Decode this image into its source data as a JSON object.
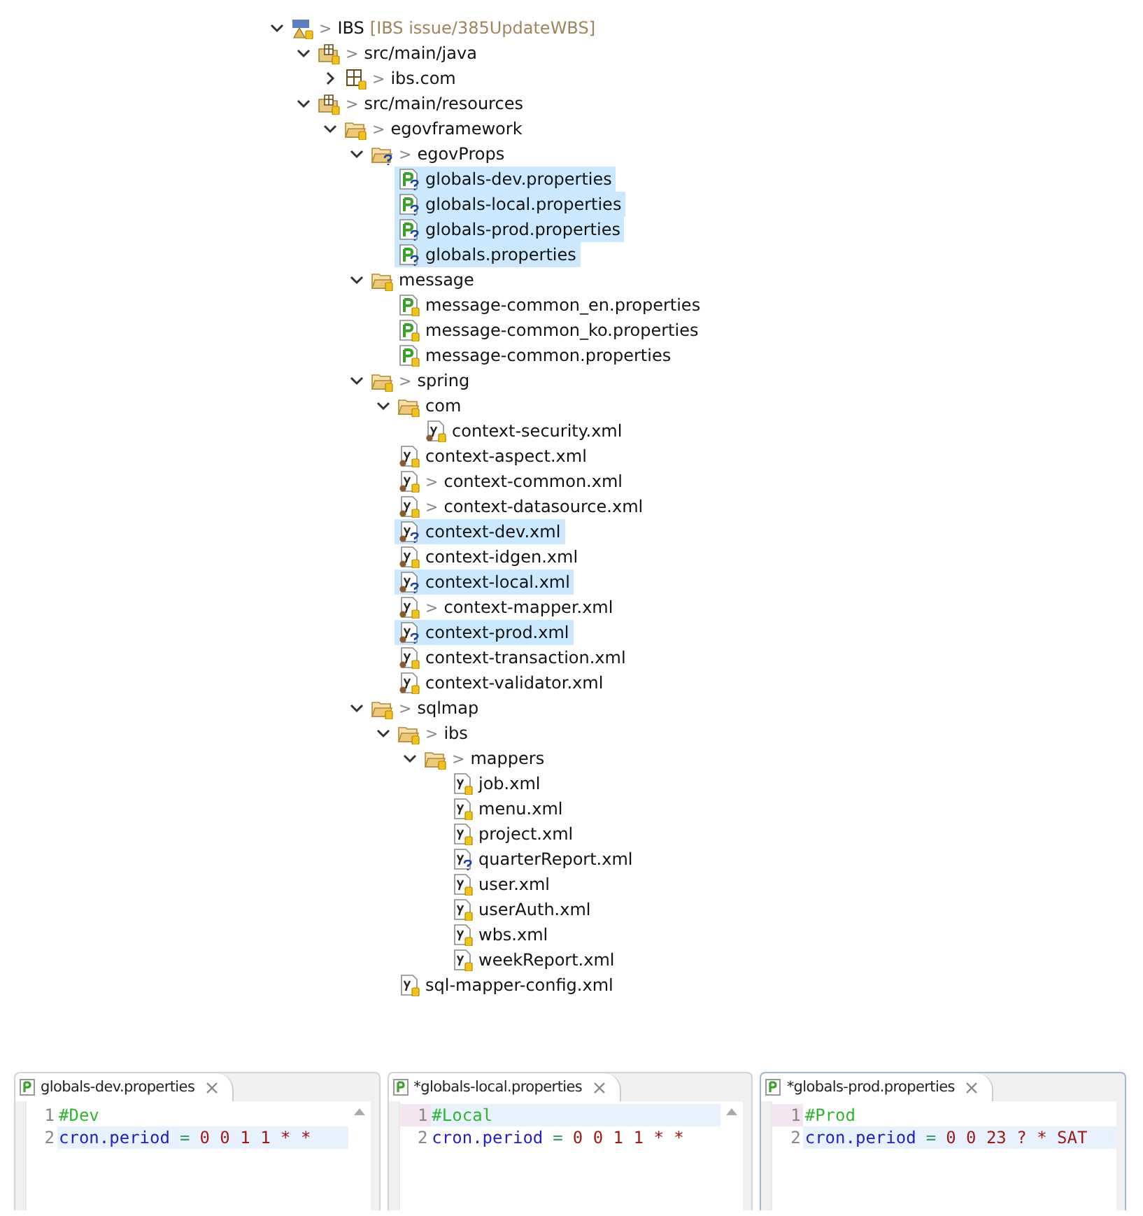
{
  "tree": [
    {
      "label": "IBS",
      "kind": "project",
      "prefix": ">",
      "branch": "[IBS issue/385UpdateWBS]",
      "untracked": false,
      "expanded": true,
      "selected": false,
      "children": [
        {
          "label": "src/main/java",
          "kind": "sourcefolder",
          "prefix": ">",
          "untracked": false,
          "expanded": true,
          "selected": false,
          "children": [
            {
              "label": "ibs.com",
              "kind": "package",
              "prefix": ">",
              "untracked": false,
              "expanded": false,
              "selected": false
            }
          ]
        },
        {
          "label": "src/main/resources",
          "kind": "sourcefolder",
          "prefix": ">",
          "untracked": false,
          "expanded": true,
          "selected": false,
          "children": [
            {
              "label": "egovframework",
              "kind": "folder",
              "prefix": ">",
              "untracked": false,
              "expanded": true,
              "selected": false,
              "children": [
                {
                  "label": "egovProps",
                  "kind": "folder",
                  "prefix": ">",
                  "untracked": true,
                  "expanded": true,
                  "selected": false,
                  "children": [
                    {
                      "label": "globals-dev.properties",
                      "kind": "properties",
                      "untracked": true,
                      "selected": true
                    },
                    {
                      "label": "globals-local.properties",
                      "kind": "properties",
                      "untracked": true,
                      "selected": true
                    },
                    {
                      "label": "globals-prod.properties",
                      "kind": "properties",
                      "untracked": true,
                      "selected": true
                    },
                    {
                      "label": "globals.properties",
                      "kind": "properties",
                      "untracked": true,
                      "selected": true
                    }
                  ]
                },
                {
                  "label": "message",
                  "kind": "folder",
                  "untracked": false,
                  "expanded": true,
                  "selected": false,
                  "children": [
                    {
                      "label": "message-common_en.properties",
                      "kind": "properties",
                      "untracked": false,
                      "selected": false
                    },
                    {
                      "label": "message-common_ko.properties",
                      "kind": "properties",
                      "untracked": false,
                      "selected": false
                    },
                    {
                      "label": "message-common.properties",
                      "kind": "properties",
                      "untracked": false,
                      "selected": false
                    }
                  ]
                },
                {
                  "label": "spring",
                  "kind": "folder",
                  "prefix": ">",
                  "untracked": false,
                  "expanded": true,
                  "selected": false,
                  "children": [
                    {
                      "label": "com",
                      "kind": "folder",
                      "untracked": false,
                      "expanded": true,
                      "selected": false,
                      "children": [
                        {
                          "label": "context-security.xml",
                          "kind": "springxml",
                          "untracked": false,
                          "selected": false
                        }
                      ]
                    },
                    {
                      "label": "context-aspect.xml",
                      "kind": "springxml",
                      "untracked": false,
                      "selected": false
                    },
                    {
                      "label": "context-common.xml",
                      "kind": "springxml",
                      "prefix": ">",
                      "untracked": false,
                      "selected": false
                    },
                    {
                      "label": "context-datasource.xml",
                      "kind": "springxml",
                      "prefix": ">",
                      "untracked": false,
                      "selected": false
                    },
                    {
                      "label": "context-dev.xml",
                      "kind": "springxml",
                      "untracked": true,
                      "selected": true
                    },
                    {
                      "label": "context-idgen.xml",
                      "kind": "springxml",
                      "untracked": false,
                      "selected": false
                    },
                    {
                      "label": "context-local.xml",
                      "kind": "springxml",
                      "untracked": true,
                      "selected": true
                    },
                    {
                      "label": "context-mapper.xml",
                      "kind": "springxml",
                      "prefix": ">",
                      "untracked": false,
                      "selected": false
                    },
                    {
                      "label": "context-prod.xml",
                      "kind": "springxml",
                      "untracked": true,
                      "selected": true
                    },
                    {
                      "label": "context-transaction.xml",
                      "kind": "springxml",
                      "untracked": false,
                      "selected": false
                    },
                    {
                      "label": "context-validator.xml",
                      "kind": "springxml",
                      "untracked": false,
                      "selected": false
                    }
                  ]
                },
                {
                  "label": "sqlmap",
                  "kind": "folder",
                  "prefix": ">",
                  "untracked": false,
                  "expanded": true,
                  "selected": false,
                  "children": [
                    {
                      "label": "ibs",
                      "kind": "folder",
                      "prefix": ">",
                      "untracked": false,
                      "expanded": true,
                      "selected": false,
                      "children": [
                        {
                          "label": "mappers",
                          "kind": "folder",
                          "prefix": ">",
                          "untracked": false,
                          "expanded": true,
                          "selected": false,
                          "children": [
                            {
                              "label": "job.xml",
                              "kind": "xml",
                              "untracked": false,
                              "selected": false
                            },
                            {
                              "label": "menu.xml",
                              "kind": "xml",
                              "untracked": false,
                              "selected": false
                            },
                            {
                              "label": "project.xml",
                              "kind": "xml",
                              "untracked": false,
                              "selected": false
                            },
                            {
                              "label": "quarterReport.xml",
                              "kind": "xml",
                              "untracked": true,
                              "selected": false
                            },
                            {
                              "label": "user.xml",
                              "kind": "xml",
                              "untracked": false,
                              "selected": false
                            },
                            {
                              "label": "userAuth.xml",
                              "kind": "xml",
                              "untracked": false,
                              "selected": false
                            },
                            {
                              "label": "wbs.xml",
                              "kind": "xml",
                              "untracked": false,
                              "selected": false
                            },
                            {
                              "label": "weekReport.xml",
                              "kind": "xml",
                              "untracked": false,
                              "selected": false
                            }
                          ]
                        }
                      ]
                    },
                    {
                      "label": "sql-mapper-config.xml",
                      "kind": "xml",
                      "untracked": false,
                      "selected": false
                    }
                  ]
                }
              ]
            }
          ]
        }
      ]
    }
  ],
  "editors": [
    {
      "title": "globals-dev.properties",
      "active": false,
      "scrollbar": true,
      "lines": [
        {
          "number": "1",
          "marked": false,
          "current": false,
          "tokens": [
            {
              "kind": "comment",
              "text": "#Dev"
            }
          ]
        },
        {
          "number": "2",
          "marked": false,
          "current": true,
          "tokens": [
            {
              "kind": "key",
              "text": "cron.period"
            },
            {
              "kind": "op",
              "text": "="
            },
            {
              "kind": "value",
              "text": "0 0 1 1 * *"
            }
          ]
        }
      ]
    },
    {
      "title": "*globals-local.properties",
      "active": false,
      "scrollbar": true,
      "lines": [
        {
          "number": "1",
          "marked": true,
          "current": true,
          "tokens": [
            {
              "kind": "comment",
              "text": "#Local"
            }
          ]
        },
        {
          "number": "2",
          "marked": false,
          "current": false,
          "tokens": [
            {
              "kind": "key",
              "text": "cron.period"
            },
            {
              "kind": "op",
              "text": "="
            },
            {
              "kind": "value",
              "text": "0 0 1 1 * *"
            }
          ]
        }
      ]
    },
    {
      "title": "*globals-prod.properties",
      "active": true,
      "scrollbar": false,
      "lines": [
        {
          "number": "1",
          "marked": true,
          "current": false,
          "tokens": [
            {
              "kind": "comment",
              "text": "#Prod"
            }
          ]
        },
        {
          "number": "2",
          "marked": false,
          "current": true,
          "tokens": [
            {
              "kind": "key",
              "text": "cron.period"
            },
            {
              "kind": "op",
              "text": "="
            },
            {
              "kind": "value",
              "text": "0 0 23 ? * SAT"
            }
          ]
        }
      ]
    }
  ]
}
